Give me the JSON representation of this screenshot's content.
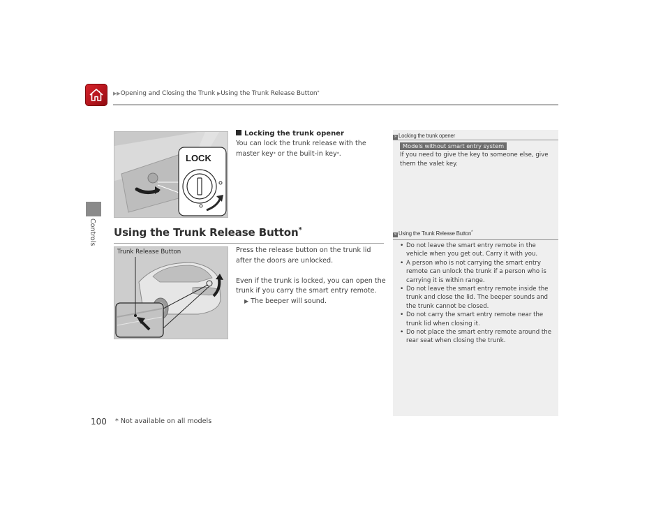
{
  "header": {
    "home_icon": "home-icon",
    "breadcrumb": {
      "separator_icon": "triangle-right-icon",
      "items": [
        "Opening and Closing the Trunk",
        "Using the Trunk Release Button"
      ],
      "asterisk": "*"
    }
  },
  "sidebar": {
    "section_label": "Controls"
  },
  "locking_section": {
    "title": "Locking the trunk opener",
    "body_part1": "You can lock the trunk release with the master key",
    "body_part2": " or the built-in key",
    "body_part3": ".",
    "asterisk": "*",
    "figure": {
      "label": "LOCK",
      "icon": "key-cylinder-lock-illustration"
    }
  },
  "release_section": {
    "heading": "Using the Trunk Release Button",
    "asterisk": "*",
    "figure_caption": "Trunk Release Button",
    "paragraph1": "Press the release button on the trunk lid after the doors are unlocked.",
    "paragraph2": "Even if the trunk is locked, you can open the trunk if you carry the smart entry remote.",
    "result": "The beeper will sound."
  },
  "side_panel": {
    "note1": {
      "title": "Locking the trunk opener",
      "badge": "Models without smart entry system",
      "text": "If you need to give the key to someone else, give them the valet key."
    },
    "note2": {
      "title": "Using the Trunk Release Button",
      "asterisk": "*",
      "bullets": [
        "Do not leave the smart entry remote in the vehicle when you get out. Carry it with you.",
        "A person who is not carrying the smart entry remote can unlock the trunk if a person who is carrying it is within range.",
        "Do not leave the smart entry remote inside the trunk and close the lid. The beeper sounds and the trunk cannot be closed.",
        "Do not carry the smart entry remote near the trunk lid when closing it.",
        "Do not place the smart entry remote around the rear seat when closing the trunk."
      ]
    }
  },
  "footer": {
    "page_number": "100",
    "footnote": "* Not available on all models"
  },
  "colors": {
    "home_red": "#c41a22",
    "panel_bg": "#efefef",
    "badge_bg": "#6d6d6d",
    "sidebar_tab": "#8a8a8a"
  }
}
